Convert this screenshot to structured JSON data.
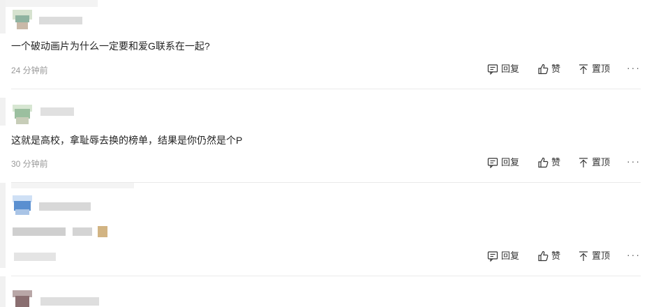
{
  "comments": [
    {
      "text": "一个破动画片为什么一定要和爱G联系在一起?",
      "time": "24 分钟前"
    },
    {
      "text": "这就是高校，拿耻辱去换的榜单，结果是你仍然是个P",
      "time": "30 分钟前"
    },
    {
      "text": "",
      "time": ""
    }
  ],
  "actions": {
    "reply": "回复",
    "like": "赞",
    "pin": "置顶",
    "more": "···"
  },
  "icons": [
    "reply-icon",
    "thumbs-up-icon",
    "pin-top-icon",
    "more-icon"
  ]
}
